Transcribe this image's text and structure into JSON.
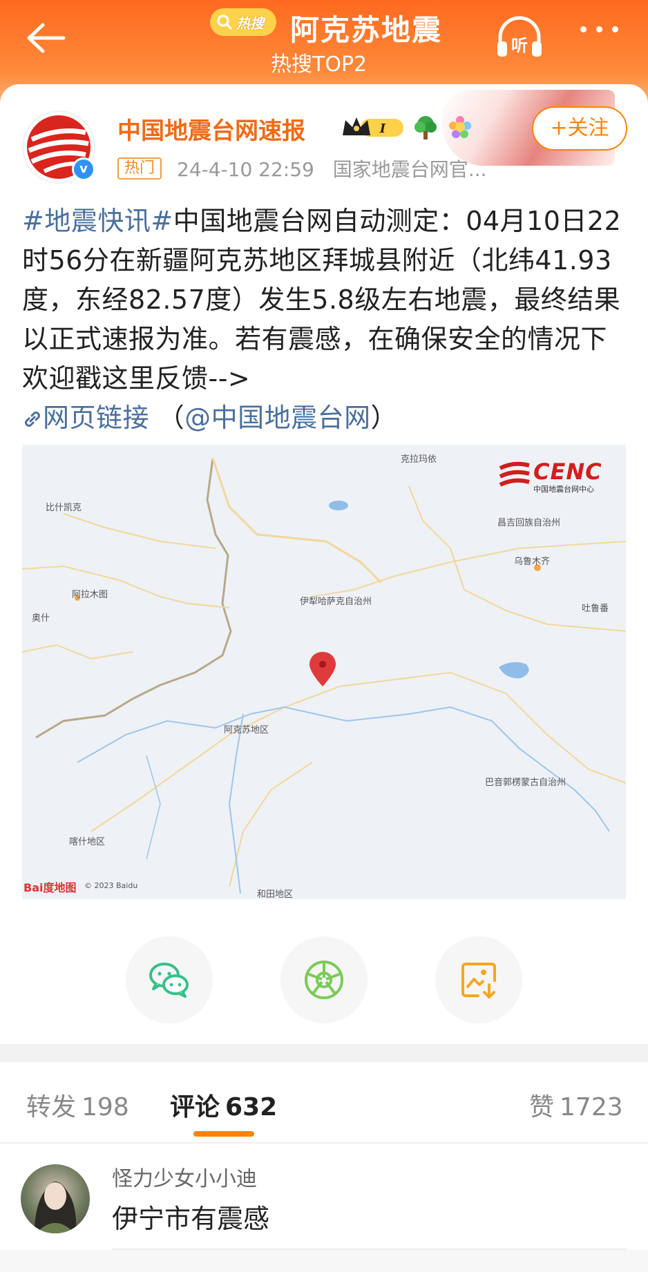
{
  "header": {
    "hot_badge": "热搜",
    "topic_title": "阿克苏地震",
    "topic_sub": "热搜TOP2",
    "listen_label": "听"
  },
  "post": {
    "author": "中国地震台网速报",
    "verified_mark": "v",
    "level_badge": "I",
    "follow_label": "+关注",
    "hot_tag": "热门",
    "time": "24-4-10 22:59",
    "source": "国家地震台网官...",
    "hashtag": "#地震快讯#",
    "body": "中国地震台网自动测定：04月10日22时56分在新疆阿克苏地区拜城县附近（北纬41.93度，东经82.57度）发生5.8级左右地震，最终结果以正式速报为准。若有震感，在确保安全的情况下欢迎戳这里反馈-->",
    "link_label": "网页链接",
    "paren_open": "（",
    "mention": "@中国地震台网",
    "paren_close": "）"
  },
  "map": {
    "logo_text": "CENC",
    "logo_sub": "中国地震台网中心",
    "attribution_logo": "Bai度地图",
    "attribution": "© 2023 Baidu",
    "labels": {
      "kelamayi": "克拉玛依",
      "bishkek": "比什凯克",
      "changji": "昌吉回族自治州",
      "urumqi": "乌鲁木齐",
      "almaty": "阿拉木图",
      "ili": "伊犁哈萨克自治州",
      "turpan": "吐鲁番",
      "osh": "奥什",
      "aksu": "阿克苏地区",
      "bayingolin": "巴音郭楞蒙古自治州",
      "kashgar": "喀什地区",
      "hotan": "和田地区"
    }
  },
  "share": {
    "wechat_icon": "wechat-icon",
    "moments_icon": "moments-icon",
    "save_icon": "save-image-icon"
  },
  "tabs": {
    "repost_label": "转发",
    "repost_count": "198",
    "comment_label": "评论",
    "comment_count": "632",
    "like_label": "赞",
    "like_count": "1723"
  },
  "comment": {
    "user": "怪力少女小小迪",
    "text": "伊宁市有震感"
  },
  "colors": {
    "accent": "#ff8200",
    "header_orange": "#ff6a1f",
    "author_orange": "#f26a16",
    "link_blue": "#4a6f9c"
  }
}
